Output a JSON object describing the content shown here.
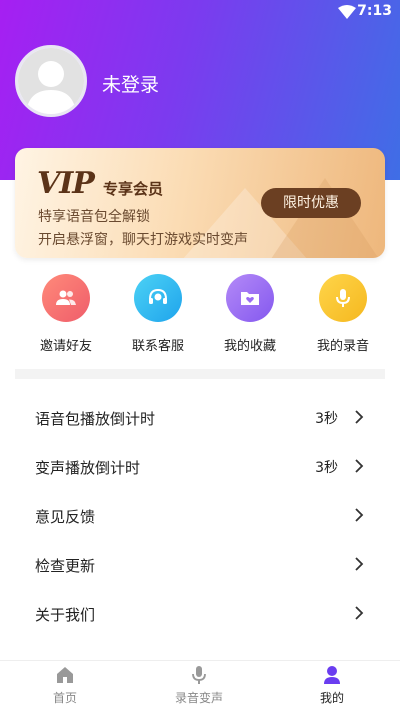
{
  "status": {
    "time": "7:13"
  },
  "profile": {
    "username": "未登录"
  },
  "vip": {
    "logo": "VIP",
    "title": "专享会员",
    "line1": "特享语音包全解锁",
    "line2": "开启悬浮窗，聊天打游戏实时变声",
    "button": "限时优惠"
  },
  "shortcuts": [
    {
      "label": "邀请好友",
      "icon": "users-icon",
      "color": "#f26a6a"
    },
    {
      "label": "联系客服",
      "icon": "headset-icon",
      "color": "#2bb6ef"
    },
    {
      "label": "我的收藏",
      "icon": "favorite-folder-icon",
      "color": "#9b6cf3"
    },
    {
      "label": "我的录音",
      "icon": "microphone-icon",
      "color": "#f7c52d"
    }
  ],
  "settings": [
    {
      "label": "语音包播放倒计时",
      "value": "3秒"
    },
    {
      "label": "变声播放倒计时",
      "value": "3秒"
    },
    {
      "label": "意见反馈",
      "value": ""
    },
    {
      "label": "检查更新",
      "value": ""
    },
    {
      "label": "关于我们",
      "value": ""
    }
  ],
  "tabs": [
    {
      "label": "首页",
      "icon": "home-icon"
    },
    {
      "label": "录音变声",
      "icon": "microphone-icon"
    },
    {
      "label": "我的",
      "icon": "profile-icon",
      "active": true
    }
  ]
}
